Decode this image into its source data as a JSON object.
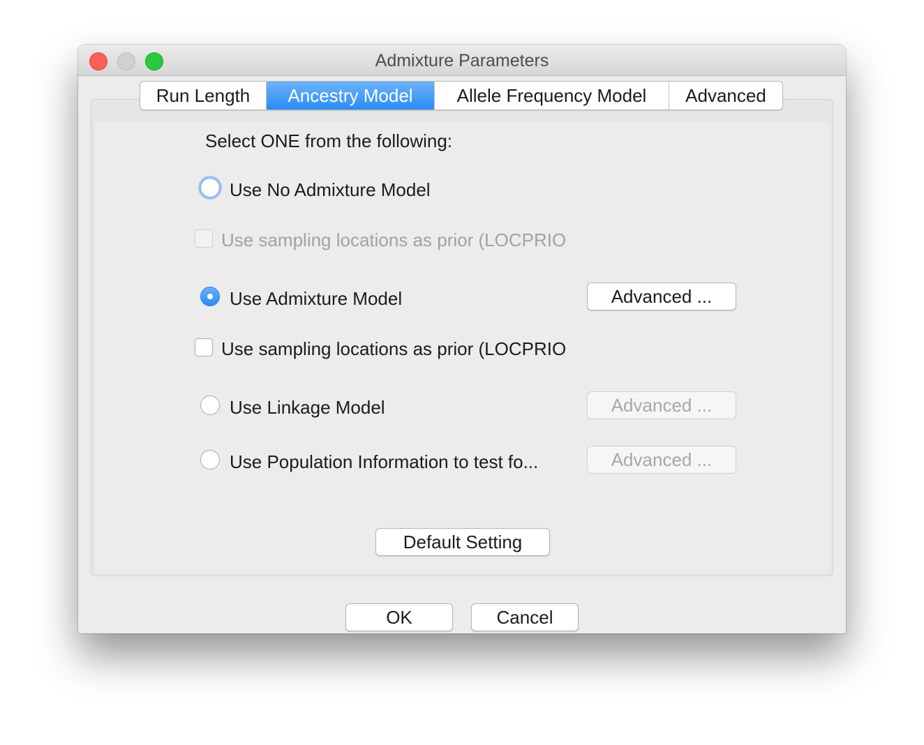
{
  "window": {
    "title": "Admixture Parameters"
  },
  "tabs": [
    {
      "label": "Run Length",
      "selected": false
    },
    {
      "label": "Ancestry Model",
      "selected": true
    },
    {
      "label": "Allele Frequency Model",
      "selected": false
    },
    {
      "label": "Advanced",
      "selected": false
    }
  ],
  "ancestry": {
    "instruction": "Select ONE from the following:",
    "no_admixture": {
      "label": "Use No Admixture Model",
      "checked": false
    },
    "locprior_1": {
      "label": "Use sampling locations as prior (LOCPRIO",
      "checked": false,
      "enabled": false
    },
    "admixture": {
      "label": "Use Admixture Model",
      "checked": true,
      "advanced_label": "Advanced ..."
    },
    "locprior_2": {
      "label": "Use sampling locations as prior (LOCPRIO",
      "checked": false,
      "enabled": true
    },
    "linkage": {
      "label": "Use Linkage Model",
      "checked": false,
      "advanced_label": "Advanced ...",
      "advanced_enabled": false
    },
    "popinfo": {
      "label": "Use Population Information to test fo...",
      "checked": false,
      "advanced_label": "Advanced ...",
      "advanced_enabled": false
    },
    "default_label": "Default Setting"
  },
  "footer": {
    "ok_label": "OK",
    "cancel_label": "Cancel"
  },
  "colors": {
    "accent": "#2a8cf6",
    "close": "#ff5f57",
    "zoom": "#28c940",
    "disabled_text": "#a2a2a2"
  }
}
